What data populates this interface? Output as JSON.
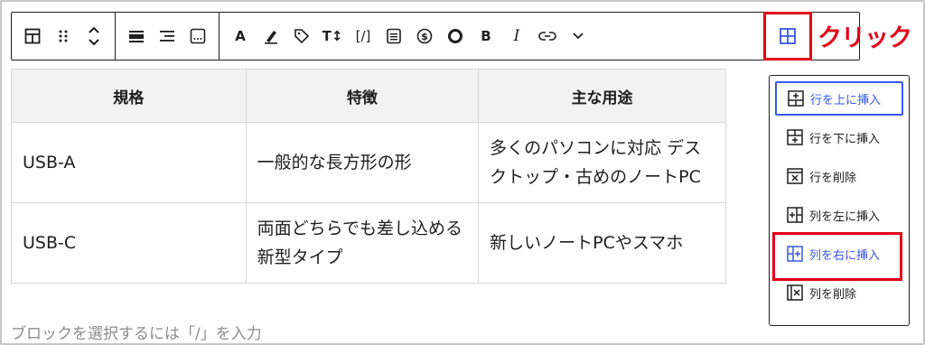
{
  "toolbar": {
    "icons": [
      "table-icon",
      "drag-handle-icon",
      "move-up-down-icon",
      "align-full-icon",
      "align-left-icon",
      "more-options-icon",
      "text-color-icon",
      "highlight-icon",
      "tag-icon",
      "font-size-icon",
      "shortcode-icon",
      "list-icon",
      "dollar-icon",
      "circle-icon",
      "bold-icon",
      "italic-icon",
      "link-icon",
      "chevron-down-icon",
      "table-edit-icon"
    ],
    "text_a": "A",
    "bold": "B",
    "italic": "I",
    "tt": "T↕",
    "shortcode": "[/]"
  },
  "annotation": "クリック",
  "table": {
    "headers": [
      "規格",
      "特徴",
      "主な用途"
    ],
    "rows": [
      [
        "USB-A",
        "一般的な長方形の形",
        "多くのパソコンに対応 デスクトップ・古めのノートPC"
      ],
      [
        "USB-C",
        "両面どちらでも差し込める新型タイプ",
        "新しいノートPCやスマホ"
      ]
    ]
  },
  "hint": "ブロックを選択するには「/」を入力",
  "menu": {
    "items": [
      {
        "label": "行を上に挿入",
        "icon": "insert-row-above-icon",
        "state": "focused"
      },
      {
        "label": "行を下に挿入",
        "icon": "insert-row-below-icon",
        "state": ""
      },
      {
        "label": "行を削除",
        "icon": "delete-row-icon",
        "state": ""
      },
      {
        "label": "列を左に挿入",
        "icon": "insert-column-left-icon",
        "state": ""
      },
      {
        "label": "列を右に挿入",
        "icon": "insert-column-right-icon",
        "state": "selected"
      },
      {
        "label": "列を削除",
        "icon": "delete-column-icon",
        "state": ""
      }
    ]
  },
  "colors": {
    "accent": "#3858e9",
    "annotation": "#e4001b",
    "header_bg": "#f2f2f2",
    "border": "#d7d7d7"
  }
}
